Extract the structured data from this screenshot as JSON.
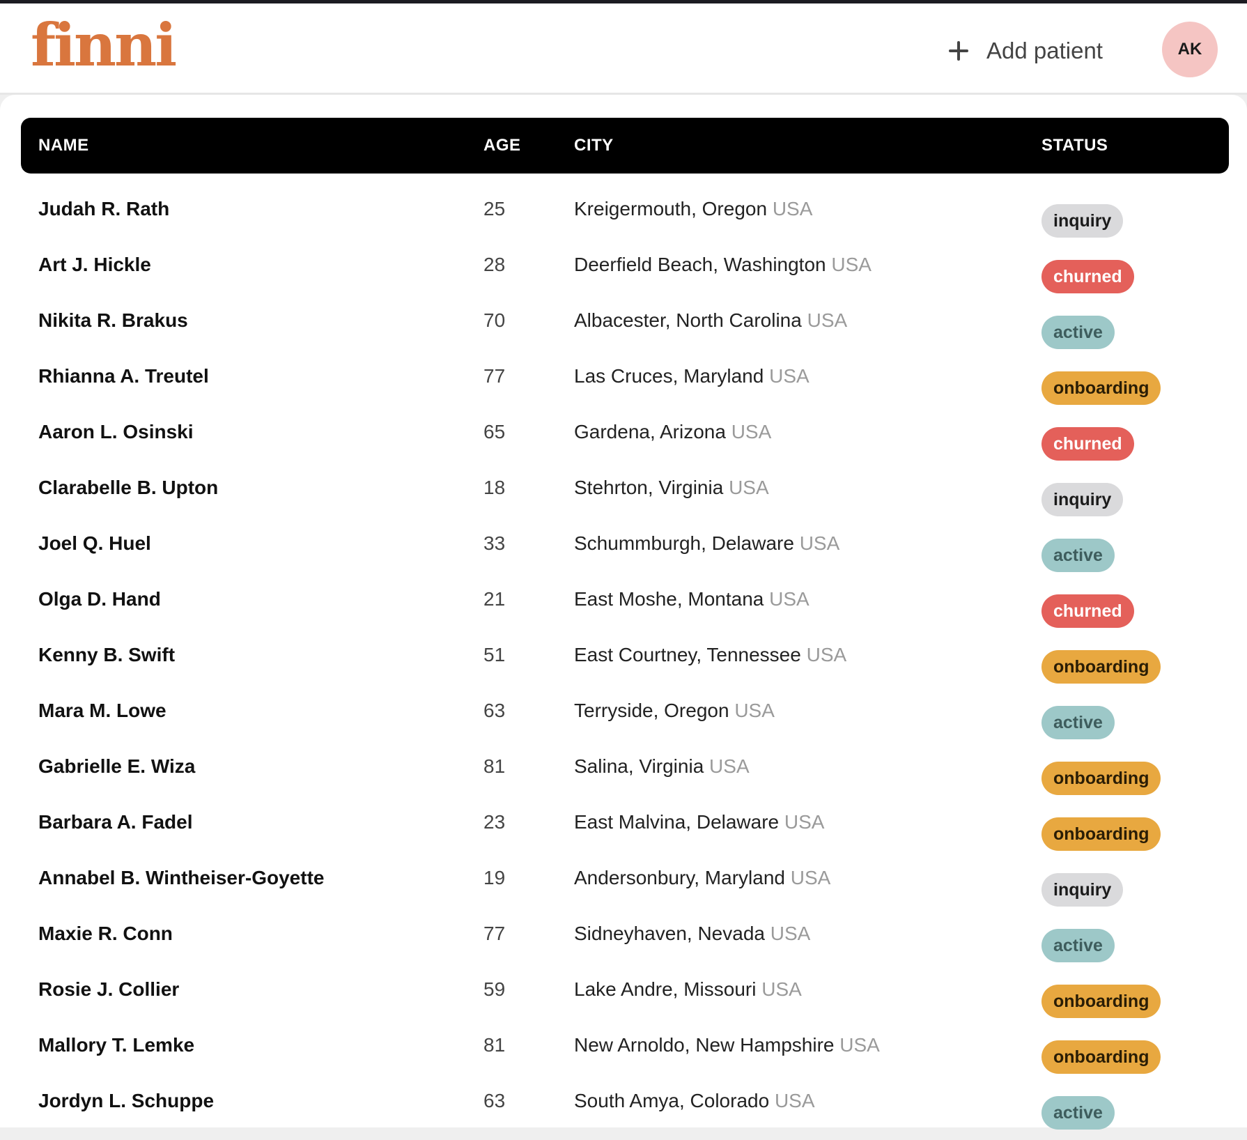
{
  "app": {
    "logo_text": "finni",
    "add_patient_label": "Add patient",
    "avatar_initials": "AK",
    "brand_color": "#d9763e"
  },
  "table": {
    "columns": {
      "name": "NAME",
      "age": "AGE",
      "city": "CITY",
      "status": "STATUS"
    },
    "rows": [
      {
        "name": "Judah R. Rath",
        "age": "25",
        "city": "Kreigermouth, Oregon",
        "country": "USA",
        "status": "inquiry"
      },
      {
        "name": "Art J. Hickle",
        "age": "28",
        "city": "Deerfield Beach, Washington",
        "country": "USA",
        "status": "churned"
      },
      {
        "name": "Nikita R. Brakus",
        "age": "70",
        "city": "Albacester, North Carolina",
        "country": "USA",
        "status": "active"
      },
      {
        "name": "Rhianna A. Treutel",
        "age": "77",
        "city": "Las Cruces, Maryland",
        "country": "USA",
        "status": "onboarding"
      },
      {
        "name": "Aaron L. Osinski",
        "age": "65",
        "city": "Gardena, Arizona",
        "country": "USA",
        "status": "churned"
      },
      {
        "name": "Clarabelle B. Upton",
        "age": "18",
        "city": "Stehrton, Virginia",
        "country": "USA",
        "status": "inquiry"
      },
      {
        "name": "Joel Q. Huel",
        "age": "33",
        "city": "Schummburgh, Delaware",
        "country": "USA",
        "status": "active"
      },
      {
        "name": "Olga D. Hand",
        "age": "21",
        "city": "East Moshe, Montana",
        "country": "USA",
        "status": "churned"
      },
      {
        "name": "Kenny B. Swift",
        "age": "51",
        "city": "East Courtney, Tennessee",
        "country": "USA",
        "status": "onboarding"
      },
      {
        "name": "Mara M. Lowe",
        "age": "63",
        "city": "Terryside, Oregon",
        "country": "USA",
        "status": "active"
      },
      {
        "name": "Gabrielle E. Wiza",
        "age": "81",
        "city": "Salina, Virginia",
        "country": "USA",
        "status": "onboarding"
      },
      {
        "name": "Barbara A. Fadel",
        "age": "23",
        "city": "East Malvina, Delaware",
        "country": "USA",
        "status": "onboarding"
      },
      {
        "name": "Annabel B. Wintheiser-Goyette",
        "age": "19",
        "city": "Andersonbury, Maryland",
        "country": "USA",
        "status": "inquiry"
      },
      {
        "name": "Maxie R. Conn",
        "age": "77",
        "city": "Sidneyhaven, Nevada",
        "country": "USA",
        "status": "active"
      },
      {
        "name": "Rosie J. Collier",
        "age": "59",
        "city": "Lake Andre, Missouri",
        "country": "USA",
        "status": "onboarding"
      },
      {
        "name": "Mallory T. Lemke",
        "age": "81",
        "city": "New Arnoldo, New Hampshire",
        "country": "USA",
        "status": "onboarding"
      },
      {
        "name": "Jordyn L. Schuppe",
        "age": "63",
        "city": "South Amya, Colorado",
        "country": "USA",
        "status": "active"
      }
    ]
  },
  "status_colors": {
    "inquiry": "#dadadc",
    "churned": "#e4605a",
    "active": "#9dc8c8",
    "onboarding": "#e8a840"
  },
  "icons": {
    "add": "plus-icon"
  }
}
